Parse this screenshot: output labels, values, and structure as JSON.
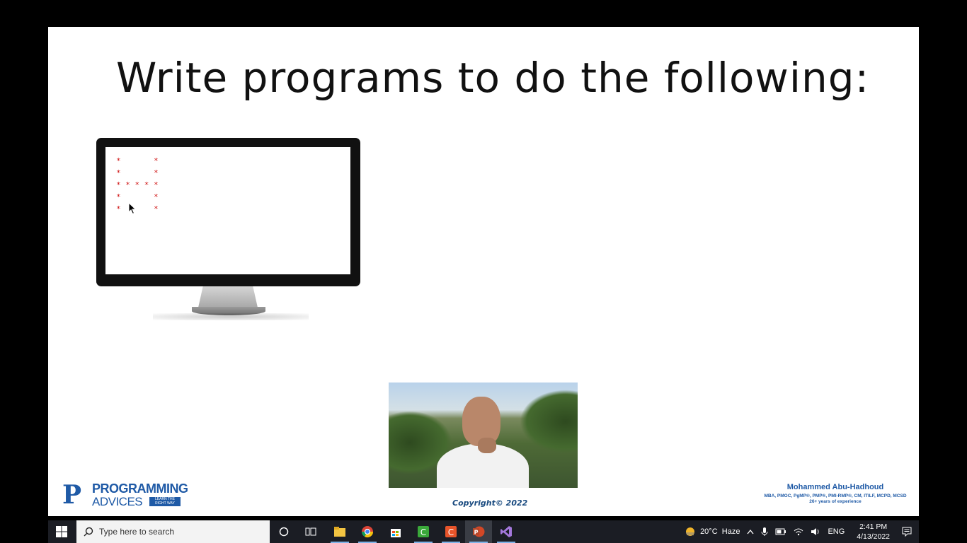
{
  "slide": {
    "title": "Write programs to do the following:",
    "monitor_output": [
      "*       *",
      "*       *",
      "* * * * *",
      "*       *",
      "*       *"
    ],
    "copyright": "Copyright© 2022",
    "logo": {
      "letter": "P",
      "main": "PROGRAMMING",
      "sub": "ADVICES",
      "tag": "LEARN THE RIGHT WAY"
    },
    "author": {
      "name": "Mohammed Abu-Hadhoud",
      "credentials": "MBA, PMOC, PgMP®, PMP®, PMI-RMP®, CM, ITILF, MCPD, MCSD",
      "experience": "26+ years of experience"
    }
  },
  "taskbar": {
    "search_placeholder": "Type here to search",
    "apps": [
      "cortana-icon",
      "task-view-icon",
      "file-explorer-icon",
      "chrome-icon",
      "microsoft-store-icon",
      "camtasia-icon",
      "camtasia-recorder-icon",
      "powerpoint-icon",
      "visual-studio-icon"
    ],
    "weather": "20°C  Haze",
    "language": "ENG",
    "time": "2:41 PM",
    "date": "4/13/2022"
  },
  "colors": {
    "star": "#d01818",
    "brand_blue": "#1f5aa6",
    "taskbar": "#1b1d24"
  }
}
